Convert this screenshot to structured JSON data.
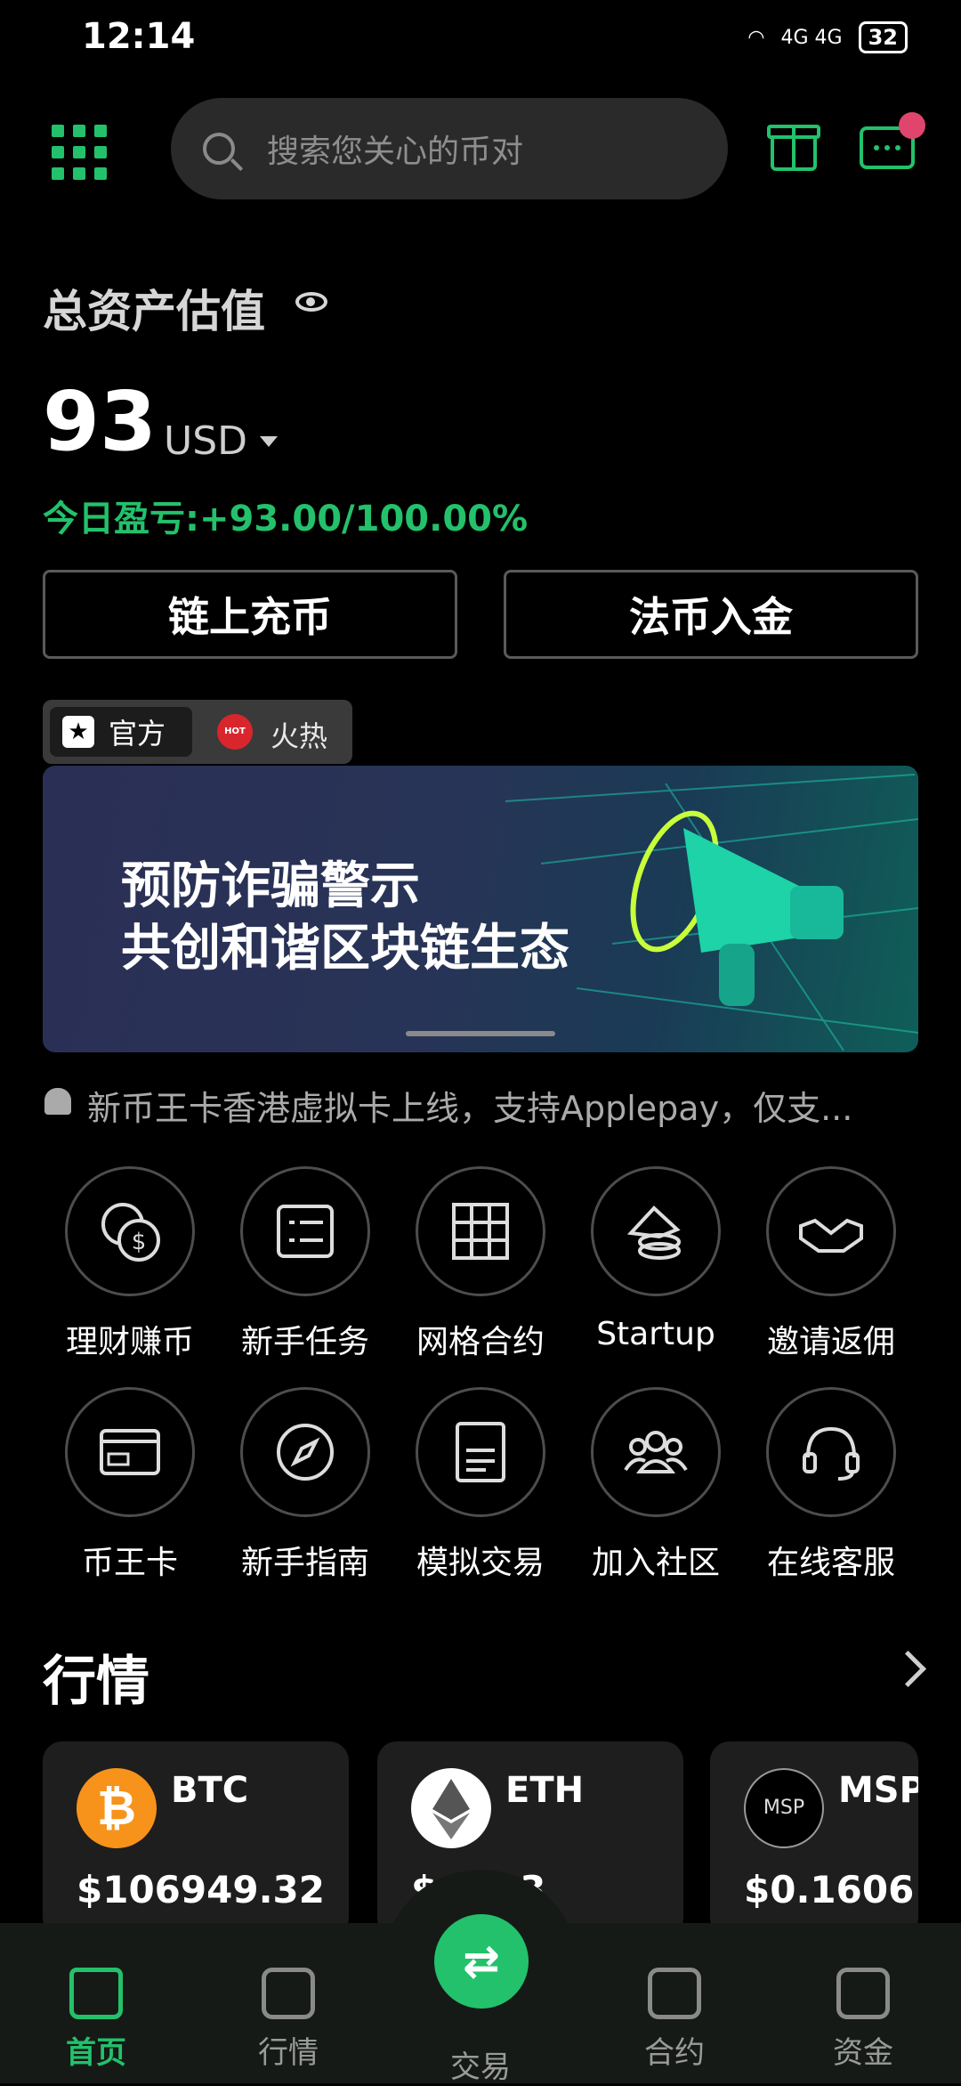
{
  "status_bar": {
    "time": "12:14",
    "network": "4G 4G",
    "battery": "32"
  },
  "header": {
    "search_placeholder": "搜索您关心的币对"
  },
  "assets": {
    "title": "总资产估值",
    "value": "93",
    "unit": "USD",
    "pnl": "今日盈亏:+93.00/100.00%",
    "btn_chain_deposit": "链上充币",
    "btn_fiat_deposit": "法币入金"
  },
  "tags": {
    "official": "官方",
    "hot": "火热",
    "hot_badge": "HOT"
  },
  "banner": {
    "line1": "预防诈骗警示",
    "line2": "共创和谐区块链生态"
  },
  "notice": "新币王卡香港虚拟卡上线，支持Applepay，仅支...",
  "shortcuts": [
    {
      "label": "理财赚币",
      "icon": "coins-icon"
    },
    {
      "label": "新手任务",
      "icon": "task-list-icon"
    },
    {
      "label": "网格合约",
      "icon": "grid-contract-icon"
    },
    {
      "label": "Startup",
      "icon": "startup-stack-icon"
    },
    {
      "label": "邀请返佣",
      "icon": "handshake-icon"
    },
    {
      "label": "币王卡",
      "icon": "card-icon"
    },
    {
      "label": "新手指南",
      "icon": "compass-icon"
    },
    {
      "label": "模拟交易",
      "icon": "document-icon"
    },
    {
      "label": "加入社区",
      "icon": "community-icon"
    },
    {
      "label": "在线客服",
      "icon": "headset-icon"
    }
  ],
  "market": {
    "title": "行情",
    "cards": [
      {
        "symbol": "BTC",
        "price": "$106949.32",
        "color": "#f7931a"
      },
      {
        "symbol": "ETH",
        "price": "$....93",
        "color": "#ffffff"
      },
      {
        "symbol": "MSP",
        "price": "$0.1606",
        "color": "#000000"
      }
    ]
  },
  "tabbar": {
    "home": "首页",
    "market": "行情",
    "trade": "交易",
    "contract": "合约",
    "funds": "资金"
  },
  "colors": {
    "accent": "#23c16b",
    "notification": "#e0456d",
    "background": "#000000"
  }
}
